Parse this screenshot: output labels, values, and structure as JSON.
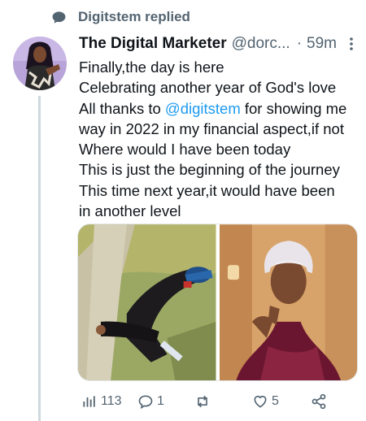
{
  "context": {
    "replied_text": "Digitstem replied"
  },
  "tweet": {
    "author_name": "The Digital Marketer",
    "author_handle": "@dorc...",
    "separator": "·",
    "time": "59m",
    "lines": [
      "Finally,the day is here",
      "Celebrating another year of God's love",
      "All thanks to ",
      "@digitstem",
      " for showing me",
      "way in 2022 in my financial aspect,if not",
      "Where would I have been today",
      "This is just the beginning of the journey",
      "This time next year,it would have been",
      "in another level"
    ]
  },
  "actions": {
    "views": "113",
    "replies": "1",
    "retweets": "",
    "likes": "5"
  },
  "colors": {
    "accent": "#1d9bf0",
    "muted": "#536471",
    "text": "#0f1419"
  }
}
